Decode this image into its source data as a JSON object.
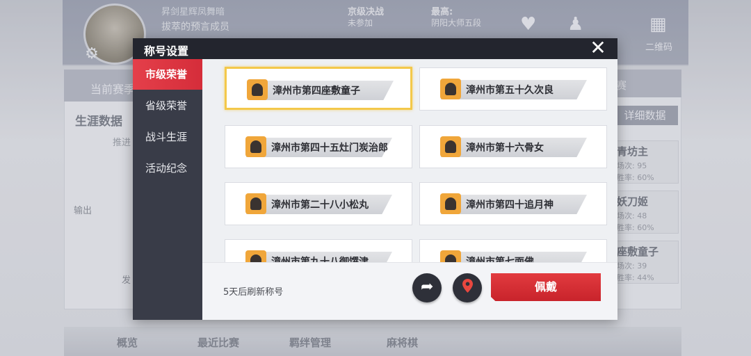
{
  "dialog": {
    "title": "称号设置",
    "close_icon": "close-icon",
    "sidebar": [
      {
        "label": "市级荣誉",
        "active": true
      },
      {
        "label": "省级荣誉",
        "active": false
      },
      {
        "label": "战斗生涯",
        "active": false
      },
      {
        "label": "活动纪念",
        "active": false
      }
    ],
    "titles": [
      {
        "label": "漳州市第四座敷童子",
        "selected": true
      },
      {
        "label": "漳州市第五十久次良",
        "selected": false
      },
      {
        "label": "漳州市第四十五灶门炭治郎",
        "selected": false
      },
      {
        "label": "漳州市第十六骨女",
        "selected": false
      },
      {
        "label": "漳州市第二十八小松丸",
        "selected": false
      },
      {
        "label": "漳州市第四十追月神",
        "selected": false
      },
      {
        "label": "漳州市第九十八御馔津",
        "selected": false
      },
      {
        "label": "漳州市第七面佛",
        "selected": false
      }
    ],
    "footer": {
      "refresh_text": "5天后刷新称号",
      "share_icon": "share-arrow-icon",
      "location_icon": "map-pin-icon",
      "wear_label": "佩戴"
    }
  },
  "background": {
    "player_name": "昇剑星辉凤舞暗",
    "player_sub": "拔萃的预言成员",
    "rank_title": "京级决战",
    "rank_sub": "未参加",
    "best_title": "最高:",
    "best_sub": "阴阳大师五段",
    "qr_label": "二维码",
    "left_tab": "当前赛季",
    "career_label": "生涯数据",
    "push_label": "推进",
    "lose_label": "输出",
    "fa_label": "发",
    "right_tab": "赛",
    "detail_button": "详细数据",
    "cards": [
      {
        "name": "青坊主",
        "line1": "场次: 95",
        "line2": "胜率: 60%"
      },
      {
        "name": "妖刀姬",
        "line1": "场次: 48",
        "line2": "胜率: 60%"
      },
      {
        "name": "座敷童子",
        "line1": "场次: 39",
        "line2": "胜率: 44%"
      }
    ],
    "bottom_nav": [
      "概览",
      "最近比赛",
      "羁绊管理",
      "麻将棋"
    ]
  },
  "colors": {
    "accent_red": "#d52d3a",
    "selected_gold": "#f3c84a",
    "header_dark": "#23252e",
    "sidebar_dark": "#393c48"
  }
}
